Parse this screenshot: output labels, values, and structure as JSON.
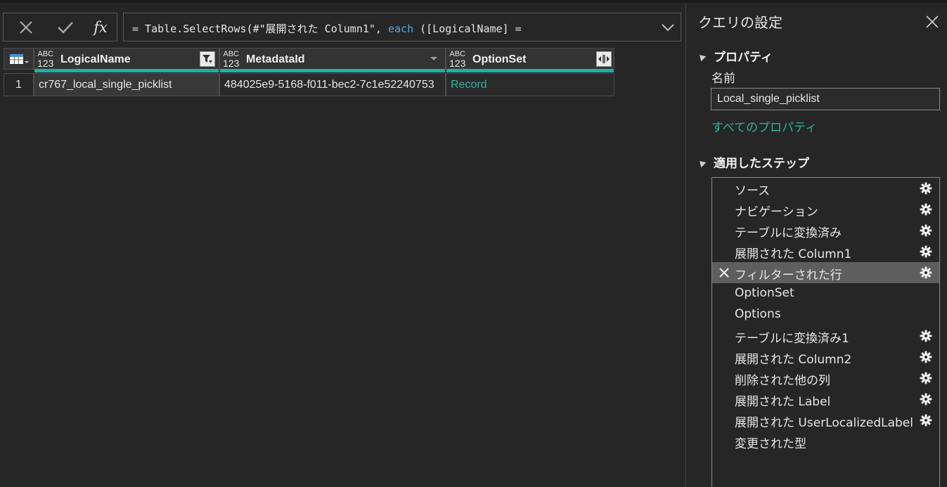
{
  "formula": {
    "text_before": "= Table.SelectRows(#\"展開された Column1\", ",
    "keyword": "each",
    "text_after": " ([LogicalName] ="
  },
  "icons": {
    "cancel": "close-icon",
    "confirm": "checkmark-icon",
    "fx": "fx-icon",
    "expand": "chevron-down-icon",
    "table": "table-icon",
    "filter": "filter-icon",
    "expand_column": "expand-column-icon",
    "gear": "gear-icon",
    "delete": "close-icon"
  },
  "table": {
    "type_icon_top": "ABC",
    "type_icon_bottom": "123",
    "columns": [
      "LogicalName",
      "MetadataId",
      "OptionSet"
    ],
    "rows": [
      {
        "num": "1",
        "cells": [
          "cr767_local_single_picklist",
          "484025e9-5168-f011-bec2-7c1e52240753",
          "Record"
        ]
      }
    ]
  },
  "pane": {
    "title": "クエリの設定",
    "properties_header": "プロパティ",
    "name_label": "名前",
    "name_value": "Local_single_picklist",
    "all_properties_link": "すべてのプロパティ",
    "steps_header": "適用したステップ",
    "steps": [
      {
        "label": "ソース",
        "gear": true
      },
      {
        "label": "ナビゲーション",
        "gear": true
      },
      {
        "label": "テーブルに変換済み",
        "gear": true
      },
      {
        "label": "展開された Column1",
        "gear": true
      },
      {
        "label": "フィルターされた行",
        "gear": true,
        "active": true
      },
      {
        "label": "OptionSet",
        "gear": false
      },
      {
        "label": "Options",
        "gear": false
      },
      {
        "label": "テーブルに変換済み1",
        "gear": true
      },
      {
        "label": "展開された Column2",
        "gear": true
      },
      {
        "label": "削除された他の列",
        "gear": true
      },
      {
        "label": "展開された Label",
        "gear": true
      },
      {
        "label": "展開された UserLocalizedLabel",
        "gear": true
      },
      {
        "label": "変更された型",
        "gear": false
      }
    ]
  },
  "colors": {
    "accent": "#1fb0a2",
    "link": "#2ab5a0",
    "background": "#262626",
    "active_step": "#5e5e5e"
  }
}
